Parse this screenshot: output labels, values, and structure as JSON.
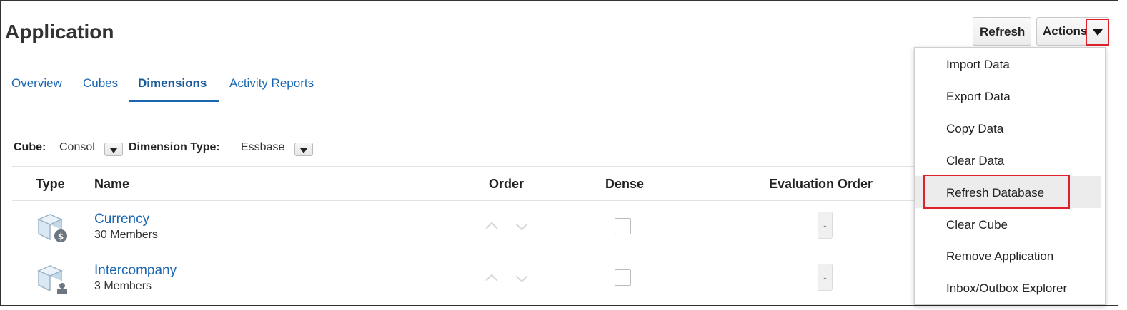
{
  "page": {
    "title": "Application"
  },
  "header_buttons": {
    "refresh": "Refresh",
    "actions": "Actions"
  },
  "tabs": [
    {
      "label": "Overview",
      "active": false
    },
    {
      "label": "Cubes",
      "active": false
    },
    {
      "label": "Dimensions",
      "active": true
    },
    {
      "label": "Activity Reports",
      "active": false
    }
  ],
  "filters": {
    "cube_label": "Cube",
    "cube_value": "Consol",
    "type_label": "Dimension Type",
    "type_value": "Essbase"
  },
  "table": {
    "columns": [
      "Type",
      "Name",
      "Order",
      "Dense",
      "Evaluation Order"
    ],
    "rows": [
      {
        "name": "Currency",
        "members": "30 Members",
        "icon": "currency-cube-icon",
        "dense": false,
        "evaluation_order": "-"
      },
      {
        "name": "Intercompany",
        "members": "3 Members",
        "icon": "entity-cube-icon",
        "dense": false,
        "evaluation_order": "-"
      }
    ]
  },
  "actions_menu": {
    "items": [
      "Import Data",
      "Export Data",
      "Copy Data",
      "Clear Data",
      "Refresh Database",
      "Clear Cube",
      "Remove Application",
      "Inbox/Outbox Explorer"
    ],
    "highlighted": "Refresh Database"
  },
  "colors": {
    "link": "#1a66b0",
    "highlight_border": "#e0202a"
  }
}
